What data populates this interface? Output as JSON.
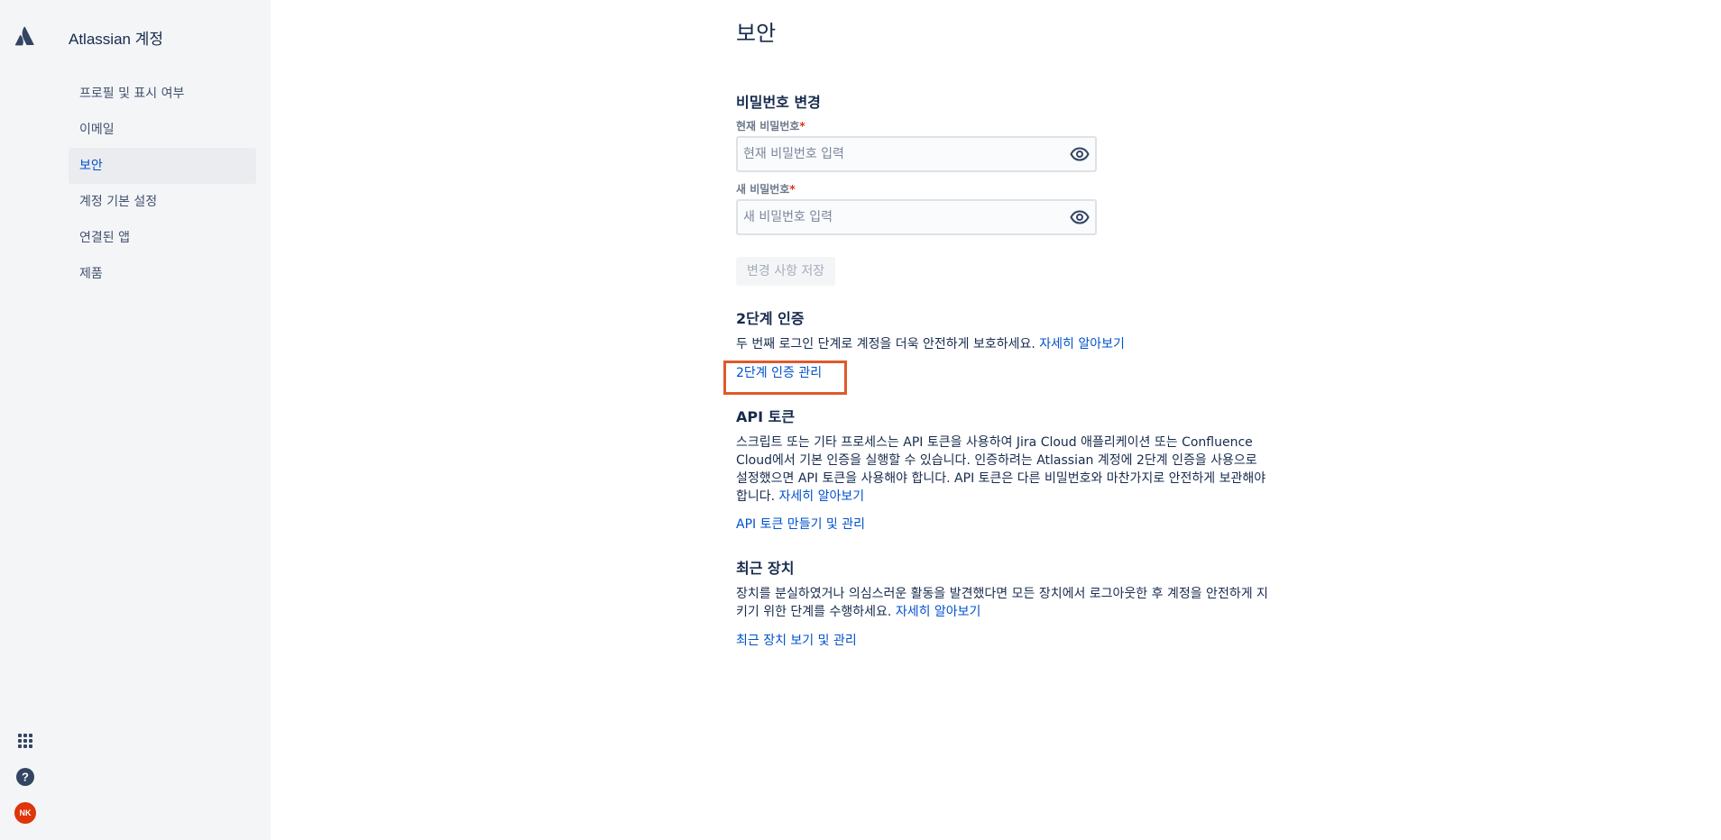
{
  "app": {
    "title": "Atlassian 계정"
  },
  "sidebar": {
    "items": [
      {
        "label": "프로필 및 표시 여부",
        "active": false
      },
      {
        "label": "이메일",
        "active": false
      },
      {
        "label": "보안",
        "active": true
      },
      {
        "label": "계정 기본 설정",
        "active": false
      },
      {
        "label": "연결된 앱",
        "active": false
      },
      {
        "label": "제품",
        "active": false
      }
    ],
    "avatar_initials": "NK",
    "bottom_icons": [
      "app-switcher-icon",
      "help-icon",
      "avatar"
    ]
  },
  "page": {
    "title": "보안"
  },
  "password": {
    "title": "비밀번호 변경",
    "current_label": "현재 비밀번호",
    "current_placeholder": "현재 비밀번호 입력",
    "new_label": "새 비밀번호",
    "new_placeholder": "새 비밀번호 입력",
    "required_mark": "*",
    "save_label": "변경 사항 저장"
  },
  "two_step": {
    "title": "2단계 인증",
    "description": "두 번째 로그인 단계로 계정을 더욱 안전하게 보호하세요.",
    "learn_more": "자세히 알아보기",
    "manage_link": "2단계 인증 관리"
  },
  "api_token": {
    "title": "API 토큰",
    "description": "스크립트 또는 기타 프로세스는 API 토큰을 사용하여 Jira Cloud 애플리케이션 또는 Confluence Cloud에서 기본 인증을 실행할 수 있습니다. 인증하려는 Atlassian 계정에 2단계 인증을 사용으로 설정했으면 API 토큰을 사용해야 합니다. API 토큰은 다른 비밀번호와 마찬가지로 안전하게 보관해야 합니다.",
    "learn_more": "자세히 알아보기",
    "manage_link": "API 토큰 만들기 및 관리"
  },
  "devices": {
    "title": "최근 장치",
    "description": "장치를 분실하였거나 의심스러운 활동을 발견했다면 모든 장치에서 로그아웃한 후 계정을 안전하게 지키기 위한 단계를 수행하세요.",
    "learn_more": "자세히 알아보기",
    "manage_link": "최근 장치 보기 및 관리"
  },
  "colors": {
    "sidebar_bg": "#F4F5F7",
    "link": "#0052CC",
    "text": "#172B4D",
    "highlight": "#E0592A",
    "avatar_bg": "#DE350B"
  }
}
